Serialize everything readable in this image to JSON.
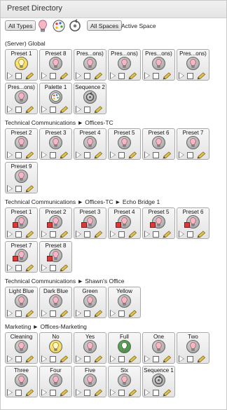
{
  "window": {
    "title": "Preset Directory"
  },
  "toolbar": {
    "all_types": "All Types",
    "all_spaces": "All Spaces",
    "active_space": "Active Space",
    "icons": [
      "lightbulb-filter-icon",
      "palette-filter-icon",
      "sequence-filter-icon"
    ]
  },
  "sections": [
    {
      "header": "(Server) Global",
      "presets": [
        {
          "label": "Preset 1",
          "bulb": "yellow"
        },
        {
          "label": "Preset 8",
          "bulb": "pink"
        },
        {
          "label": "Pres...ons)",
          "bulb": "pink"
        },
        {
          "label": "Pres...ons)",
          "bulb": "pink"
        },
        {
          "label": "Pres...ons)",
          "bulb": "pink"
        },
        {
          "label": "Pres...ons)",
          "bulb": "pink"
        },
        {
          "label": "Pres...ons)",
          "bulb": "pink"
        },
        {
          "label": "Palette 1",
          "bulb": "palette"
        },
        {
          "label": "Sequence 2",
          "bulb": "sequence"
        }
      ]
    },
    {
      "header": "Technical Communications ► Offices-TC",
      "presets": [
        {
          "label": "Preset 2",
          "bulb": "pink"
        },
        {
          "label": "Preset 3",
          "bulb": "pink"
        },
        {
          "label": "Preset 4",
          "bulb": "pink"
        },
        {
          "label": "Preset 5",
          "bulb": "pink"
        },
        {
          "label": "Preset 6",
          "bulb": "pink"
        },
        {
          "label": "Preset 7",
          "bulb": "pink"
        },
        {
          "label": "Preset 9",
          "bulb": "pink"
        }
      ]
    },
    {
      "header": "Technical Communications ► Offices-TC ► Echo Bridge 1",
      "presets": [
        {
          "label": "Preset 1",
          "bulb": "pink",
          "badge": true
        },
        {
          "label": "Preset 2",
          "bulb": "pink",
          "badge": true
        },
        {
          "label": "Preset 3",
          "bulb": "pink",
          "badge": true
        },
        {
          "label": "Preset 4",
          "bulb": "pink",
          "badge": true
        },
        {
          "label": "Preset 5",
          "bulb": "pink",
          "badge": true
        },
        {
          "label": "Preset 6",
          "bulb": "pink",
          "badge": true
        },
        {
          "label": "Preset 7",
          "bulb": "pink",
          "badge": true
        },
        {
          "label": "Preset 8",
          "bulb": "pink",
          "badge": true
        }
      ]
    },
    {
      "header": "Technical Communications ► Shawn's Office",
      "presets": [
        {
          "label": "Light Blue",
          "bulb": "pink"
        },
        {
          "label": "Dark Blue",
          "bulb": "pink"
        },
        {
          "label": "Green",
          "bulb": "pink"
        },
        {
          "label": "Yellow",
          "bulb": "pink"
        }
      ]
    },
    {
      "header": "Marketing ► Offices-Marketing",
      "presets": [
        {
          "label": "Cleaning",
          "bulb": "pink"
        },
        {
          "label": "No",
          "bulb": "yellow"
        },
        {
          "label": "Yes",
          "bulb": "pink"
        },
        {
          "label": "Full",
          "bulb": "green"
        },
        {
          "label": "One",
          "bulb": "pink"
        },
        {
          "label": "Two",
          "bulb": "pink"
        },
        {
          "label": "Three",
          "bulb": "pink"
        },
        {
          "label": "Four",
          "bulb": "pink"
        },
        {
          "label": "Five",
          "bulb": "pink"
        },
        {
          "label": "Six",
          "bulb": "pink"
        },
        {
          "label": "Sequence 1",
          "bulb": "sequence"
        }
      ]
    }
  ],
  "colors": {
    "accent_yellow": "#f1d44a",
    "accent_green": "#3d8d3a",
    "bulb_pink": "#f6b7c4",
    "edit_pencil": "#e2c04a"
  }
}
